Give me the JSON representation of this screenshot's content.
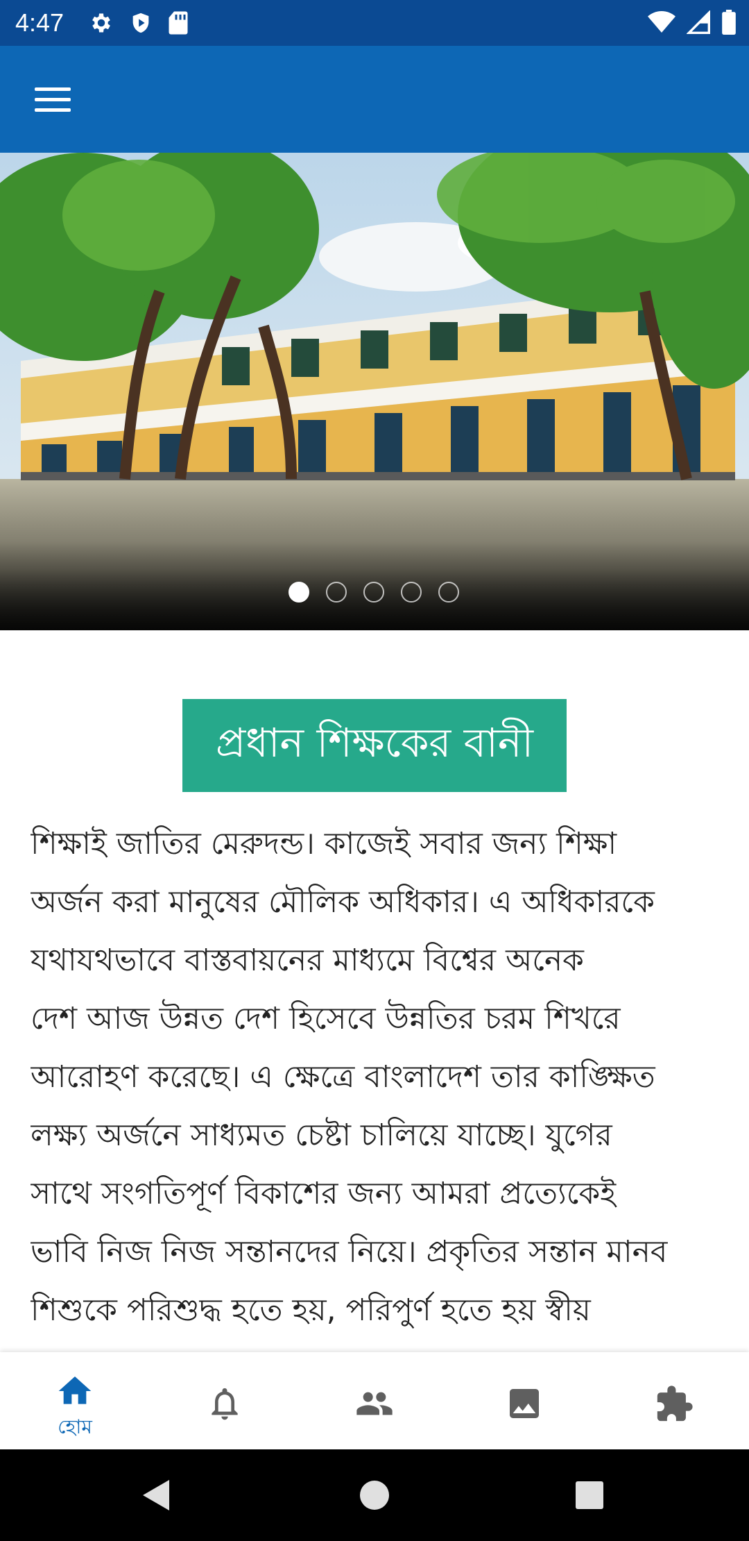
{
  "status_bar": {
    "time": "4:47",
    "left_icons": [
      "gear-icon",
      "shield-icon",
      "sd-card-icon"
    ],
    "right_icons": [
      "wifi-icon",
      "signal-icon",
      "battery-icon"
    ]
  },
  "app_bar": {
    "menu_icon": "hamburger-menu-icon"
  },
  "carousel": {
    "slide_count": 5,
    "active_index": 0
  },
  "section": {
    "heading": "প্রধান শিক্ষকের বানী",
    "lines": [
      "শিক্ষাই জাতির মেরুদন্ড। কাজেই সবার জন্য শিক্ষা",
      "অর্জন করা মানুষের মৌলিক অধিকার। এ অধিকারকে",
      "যথাযথভাবে বাস্তবায়নের মাধ্যমে বিশ্বের অনেক",
      "দেশ আজ উন্নত দেশ হিসেবে উন্নতির চরম শিখরে",
      "আরোহণ করেছে। এ ক্ষেত্রে বাংলাদেশ তার কাঙ্ক্ষিত",
      "লক্ষ্য অর্জনে সাধ্যমত চেষ্টা চালিয়ে যাচ্ছে। যুগের",
      "সাথে সংগতিপূর্ণ বিকাশের জন্য আমরা প্রত্যেকেই",
      "ভাবি নিজ নিজ সন্তানদের নিয়ে। প্রকৃতির সন্তান মানব",
      "শিশুকে পরিশুদ্ধ হতে হয়, পরিপুর্ণ হতে হয় স্বীয়"
    ]
  },
  "bottom_nav": {
    "items": [
      {
        "icon": "home-icon",
        "label": "হোম",
        "active": true
      },
      {
        "icon": "bell-icon",
        "label": "",
        "active": false
      },
      {
        "icon": "people-icon",
        "label": "",
        "active": false
      },
      {
        "icon": "image-icon",
        "label": "",
        "active": false
      },
      {
        "icon": "puzzle-icon",
        "label": "",
        "active": false
      }
    ]
  },
  "colors": {
    "status_bar": "#0b4a93",
    "app_bar": "#0d67b5",
    "heading_bg": "#26a98b",
    "nav_active": "#0d67b5",
    "nav_inactive": "#5f5f5f"
  }
}
